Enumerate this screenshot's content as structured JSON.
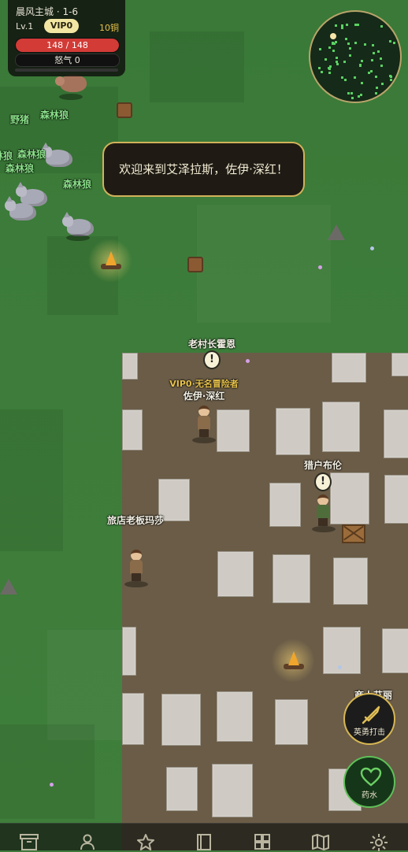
{
  "hud": {
    "location": "晨风主城 · 1-6",
    "level": "Lv.1",
    "vip": "VIP0",
    "coins": "10铜",
    "hp_text": "148 / 148",
    "hp_fraction": 1.0,
    "rage_text": "怒气 0",
    "rage_fraction": 0
  },
  "banner": "欢迎来到艾泽拉斯，佐伊·深红！",
  "enemies": {
    "boar": "野猪",
    "wolf": "森林狼",
    "wolf_partial": "林狼"
  },
  "npcs": {
    "elder": "老村长霍恩",
    "hunter": "猎户布伦",
    "innkeeper": "旅店老板玛莎",
    "merchant_partial": "商人艾丽"
  },
  "player": {
    "title": "VIP0·无名冒险者",
    "name": "佐伊·深红"
  },
  "quest_marker": "!",
  "skills": {
    "strike_label": "英勇打击",
    "potion_label": "药水"
  },
  "colors": {
    "grass": "#3d7c3a",
    "plaza": "#6a5c47",
    "hp": "#d23b36",
    "gold_border": "#d1b25a",
    "enemy_label": "#8be08a"
  },
  "bottom_nav": [
    "box-icon",
    "character-icon",
    "star-icon",
    "book-icon",
    "grid-icon",
    "map-icon",
    "settings-icon"
  ]
}
